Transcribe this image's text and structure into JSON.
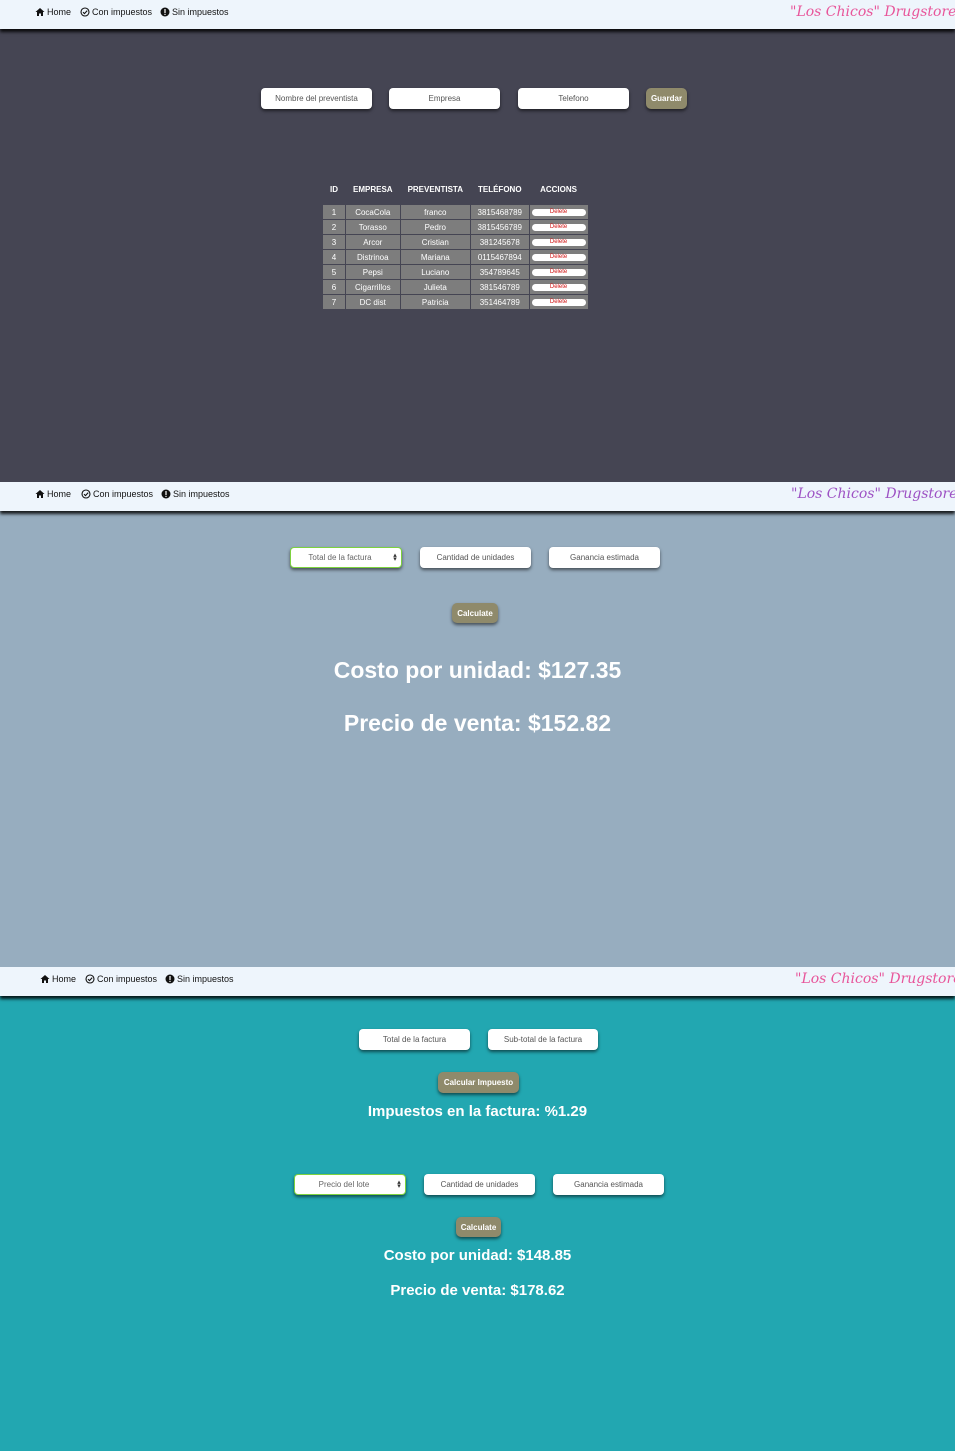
{
  "nav": {
    "home": "Home",
    "con_impuestos": "Con impuestos",
    "sin_impuestos": "Sin impuestos",
    "brand": "\"Los Chicos\" Drugstore"
  },
  "colors": {
    "brand_pink": "#e8559a",
    "brand_purple": "#9d52c4",
    "button": "#8f8a6b",
    "section1_bg": "#454553",
    "section2_bg": "#97adbf",
    "section3_bg": "#22a7b1"
  },
  "icons": {
    "home": "home-icon",
    "con": "check-circle-icon",
    "sin": "info-circle-icon"
  },
  "preventistas": {
    "form": {
      "nombre_placeholder": "Nombre del preventista",
      "empresa_placeholder": "Empresa",
      "telefono_placeholder": "Telefono",
      "guardar": "Guardar"
    },
    "headers": [
      "ID",
      "EMPRESA",
      "PREVENTISTA",
      "TELÉFONO",
      "ACCIONS"
    ],
    "delete_label": "Delete",
    "rows": [
      {
        "id": "1",
        "empresa": "CocaCola",
        "preventista": "franco",
        "telefono": "3815468789"
      },
      {
        "id": "2",
        "empresa": "Torasso",
        "preventista": "Pedro",
        "telefono": "3815456789"
      },
      {
        "id": "3",
        "empresa": "Arcor",
        "preventista": "Cristian",
        "telefono": "381245678"
      },
      {
        "id": "4",
        "empresa": "Distrinoa",
        "preventista": "Mariana",
        "telefono": "0115467894"
      },
      {
        "id": "5",
        "empresa": "Pepsi",
        "preventista": "Luciano",
        "telefono": "354789645"
      },
      {
        "id": "6",
        "empresa": "Cigarrillos",
        "preventista": "Julieta",
        "telefono": "381546789"
      },
      {
        "id": "7",
        "empresa": "DC dist",
        "preventista": "Patricia",
        "telefono": "351464789"
      }
    ]
  },
  "sin_impuestos": {
    "select_value": "Total de la factura",
    "cantidad_placeholder": "Cantidad de unidades",
    "ganancia_placeholder": "Ganancia estimada",
    "calculate": "Calculate",
    "costo": "Costo por unidad: $127.35",
    "precio": "Precio de venta: $152.82"
  },
  "con_impuestos": {
    "total_placeholder": "Total de la factura",
    "subtotal_placeholder": "Sub-total de la factura",
    "calcular_impuesto": "Calcular Impuesto",
    "impuestos": "Impuestos en la factura: %1.29",
    "select_value": "Precio del lote",
    "cantidad_placeholder": "Cantidad de unidades",
    "ganancia_placeholder": "Ganancia estimada",
    "calculate": "Calculate",
    "costo": "Costo por unidad: $148.85",
    "precio": "Precio de venta: $178.62"
  }
}
